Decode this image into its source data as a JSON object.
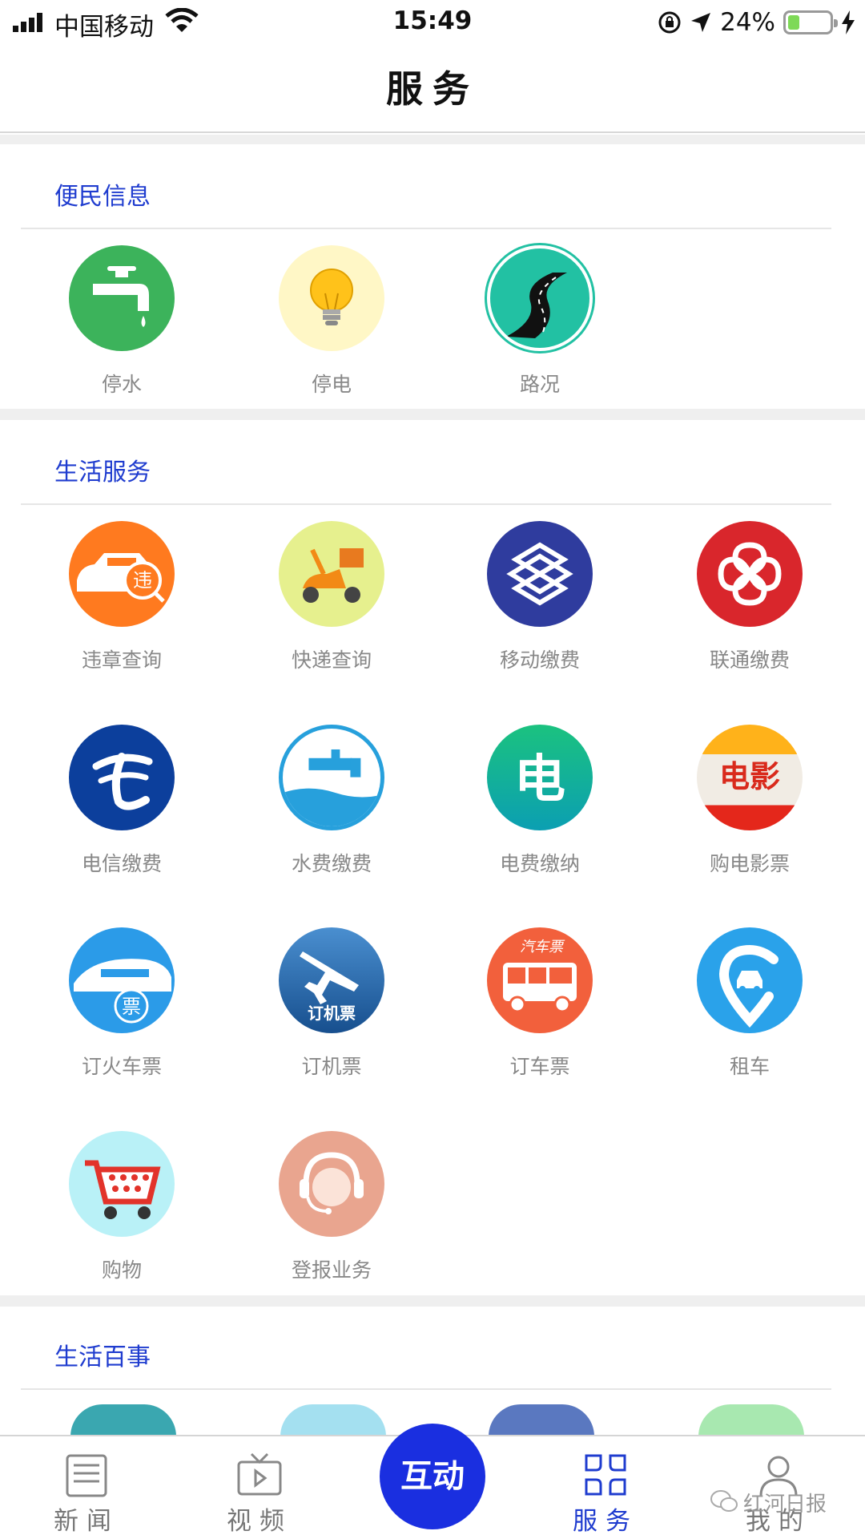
{
  "status_bar": {
    "carrier": "中国移动",
    "time": "15:49",
    "battery": "24%"
  },
  "header": {
    "title": "服务"
  },
  "sections": [
    {
      "title": "便民信息",
      "items": [
        {
          "label": "停水",
          "icon": "faucet-icon",
          "color": "#3cb35b"
        },
        {
          "label": "停电",
          "icon": "lightbulb-icon",
          "color": "#fff7c6"
        },
        {
          "label": "路况",
          "icon": "road-icon",
          "color": "#22c1a3"
        }
      ]
    },
    {
      "title": "生活服务",
      "items": [
        {
          "label": "违章查询",
          "icon": "car-violation-icon",
          "color": "#ff7a1f"
        },
        {
          "label": "快递查询",
          "icon": "scooter-icon",
          "color": "#e6f08e"
        },
        {
          "label": "移动缴费",
          "icon": "china-mobile-icon",
          "color": "#2f3c9e"
        },
        {
          "label": "联通缴费",
          "icon": "china-unicom-icon",
          "color": "#d9262c"
        },
        {
          "label": "电信缴费",
          "icon": "china-telecom-icon",
          "color": "#0c3f9c"
        },
        {
          "label": "水费缴费",
          "icon": "water-bill-icon",
          "color": "#27a0dc"
        },
        {
          "label": "电费缴纳",
          "icon": "electric-bill-icon",
          "color": "#12b39a"
        },
        {
          "label": "购电影票",
          "icon": "movie-ticket-icon",
          "color": "#e73d2b"
        },
        {
          "label": "订火车票",
          "icon": "train-icon",
          "color": "#2b9be8"
        },
        {
          "label": "订机票",
          "icon": "plane-icon",
          "color": "#1e5d9c"
        },
        {
          "label": "订车票",
          "icon": "bus-icon",
          "color": "#f2603c"
        },
        {
          "label": "租车",
          "icon": "car-rental-icon",
          "color": "#2aa2ea"
        },
        {
          "label": "购物",
          "icon": "shopping-cart-icon",
          "color": "#b9f1f7"
        },
        {
          "label": "登报业务",
          "icon": "customer-service-icon",
          "color": "#e9a58f"
        }
      ]
    },
    {
      "title": "生活百事",
      "items": []
    }
  ],
  "overlay_labels": {
    "violation_badge": "违",
    "electric": "电",
    "movie": "电影",
    "ticket": "票",
    "plane_ticket": "订机票",
    "bus_ticket": "汽车票"
  },
  "bottom_nav": {
    "items": [
      {
        "label": "新闻",
        "icon": "news-icon"
      },
      {
        "label": "视频",
        "icon": "video-icon"
      },
      {
        "label": "服务",
        "icon": "service-grid-icon",
        "active": true
      },
      {
        "label": "我的",
        "icon": "user-icon"
      }
    ],
    "center_button": "互动",
    "watermark": "红河日报",
    "active_color": "#1f3ccf"
  }
}
